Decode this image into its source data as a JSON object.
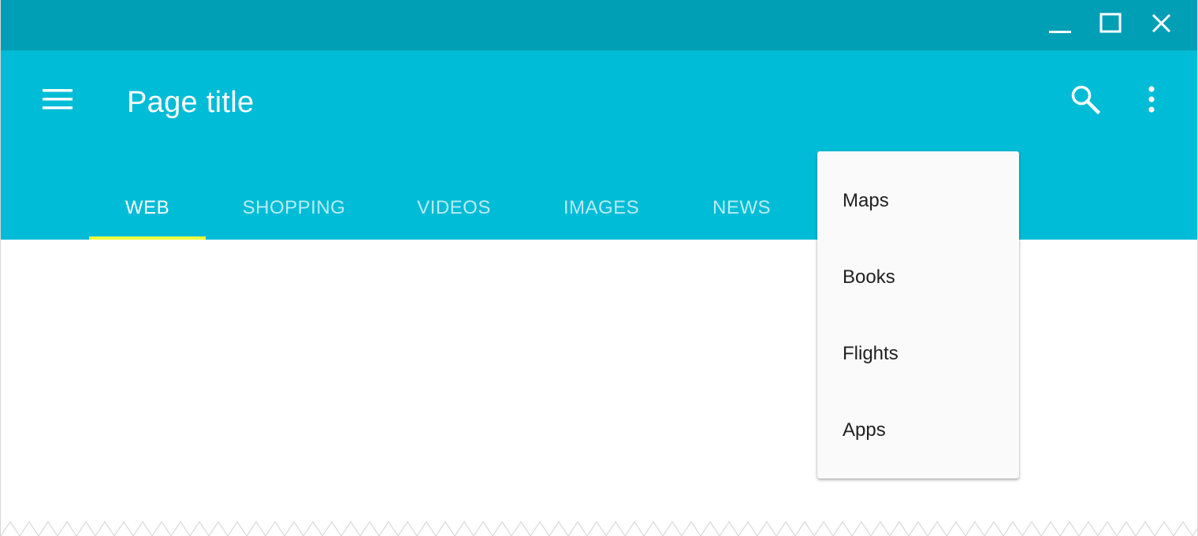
{
  "window": {
    "controls": {
      "minimize_icon": "minimize-icon",
      "maximize_icon": "maximize-icon",
      "close_icon": "close-icon"
    },
    "titlebar_color": "#009fb5"
  },
  "appbar": {
    "title": "Page title",
    "color": "#00bcd6",
    "menu_icon": "hamburger-menu-icon",
    "search_icon": "search-icon",
    "more_icon": "more-vertical-icon"
  },
  "tabs": [
    {
      "label": "WEB",
      "active": true
    },
    {
      "label": "SHOPPING",
      "active": false
    },
    {
      "label": "VIDEOS",
      "active": false
    },
    {
      "label": "IMAGES",
      "active": false
    },
    {
      "label": "NEWS",
      "active": false
    }
  ],
  "tab_indicator_color": "#eeff41",
  "dropdown": {
    "items": [
      {
        "label": "Maps"
      },
      {
        "label": "Books"
      },
      {
        "label": "Flights"
      },
      {
        "label": "Apps"
      }
    ]
  }
}
